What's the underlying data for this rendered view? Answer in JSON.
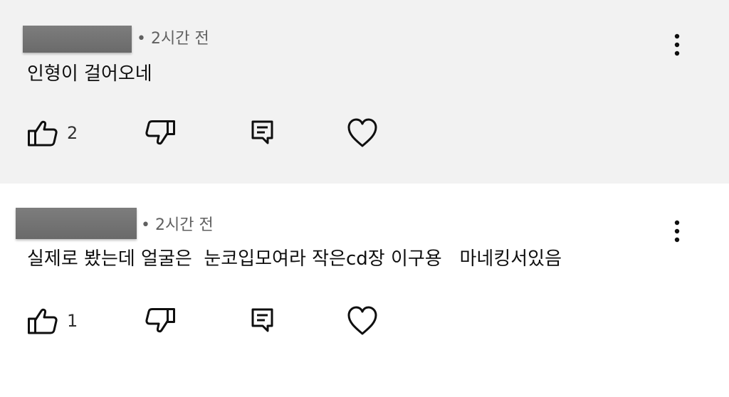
{
  "comments": [
    {
      "time": "• 2시간 전",
      "text": "인형이 걸어오네",
      "likes": "2",
      "icons": [
        "like-icon",
        "dislike-icon",
        "reply-icon",
        "heart-icon",
        "more-vert-icon"
      ]
    },
    {
      "time": "• 2시간 전",
      "text": "실제로 봤는데 얼굴은  눈코입모여라 작은cd장 이구용   마네킹서있음",
      "likes": "1",
      "icons": [
        "like-icon",
        "dislike-icon",
        "reply-icon",
        "heart-icon",
        "more-vert-icon"
      ]
    }
  ],
  "colors": {
    "highlight_bg": "#f2f2f2",
    "background": "#ffffff",
    "text": "#0f0f0f",
    "meta_text": "#606060",
    "redaction": "#737373"
  }
}
